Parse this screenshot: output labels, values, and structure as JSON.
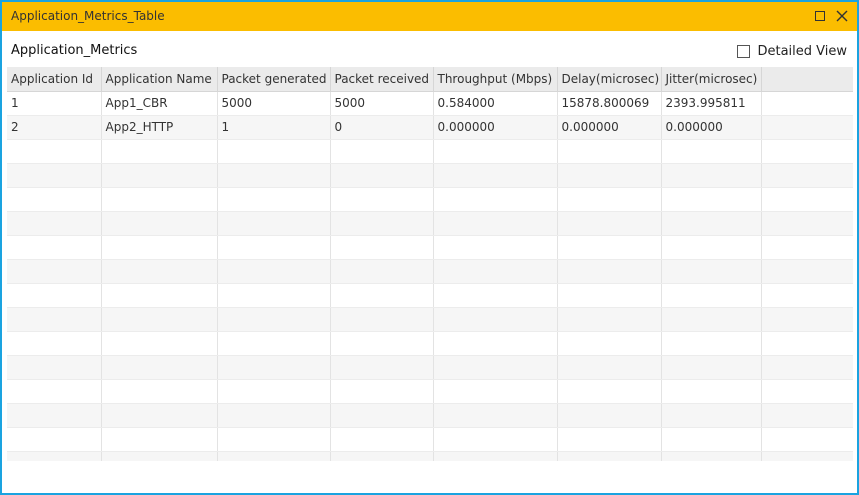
{
  "window": {
    "title": "Application_Metrics_Table"
  },
  "header": {
    "title": "Application_Metrics",
    "detailed_view_label": "Detailed View",
    "detailed_view_checked": false
  },
  "table": {
    "columns": [
      "Application Id",
      "Application Name",
      "Packet generated",
      "Packet received",
      "Throughput (Mbps)",
      "Delay(microsec)",
      "Jitter(microsec)",
      ""
    ],
    "rows": [
      [
        "1",
        "App1_CBR",
        "5000",
        "5000",
        "0.584000",
        "15878.800069",
        "2393.995811",
        ""
      ],
      [
        "2",
        "App2_HTTP",
        "1",
        "0",
        "0.000000",
        "0.000000",
        "0.000000",
        ""
      ]
    ]
  },
  "colors": {
    "titlebar": "#fbbd00",
    "window_border": "#1aa3e0",
    "header_bg": "#ebebeb"
  }
}
